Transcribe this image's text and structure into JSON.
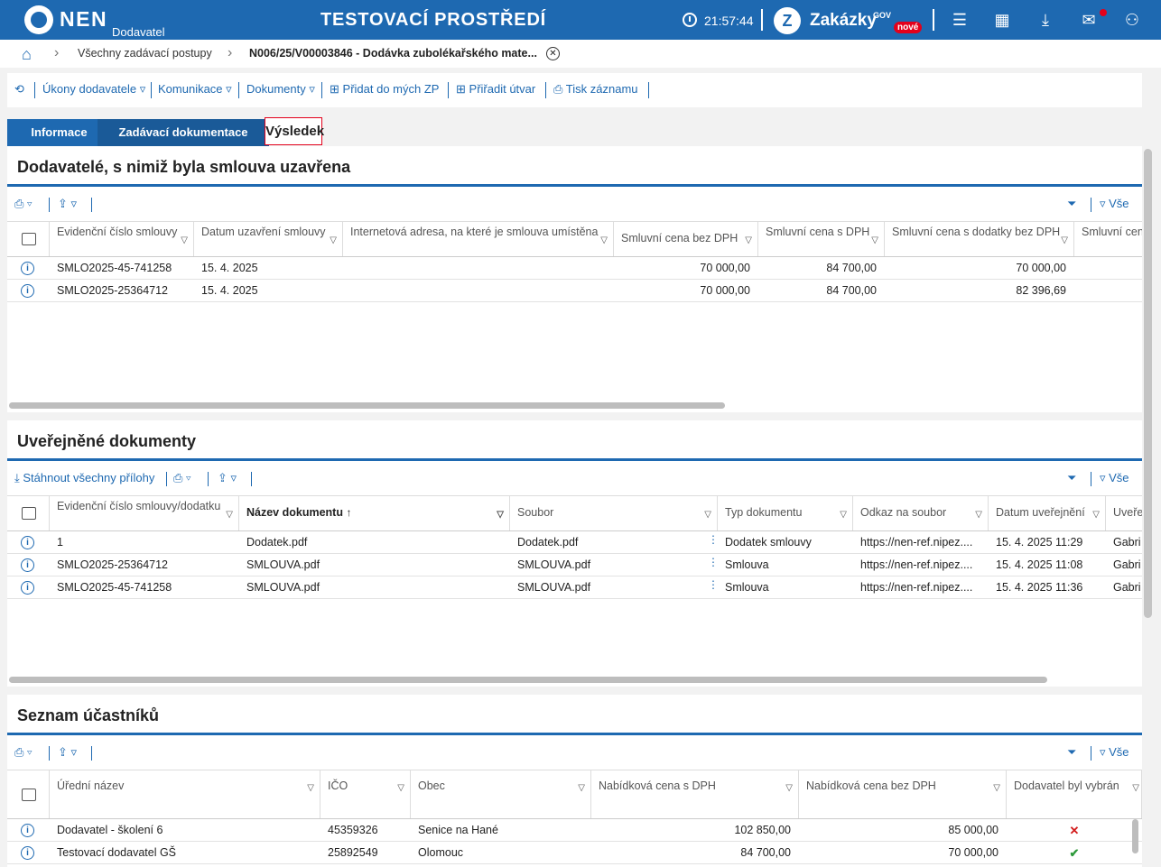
{
  "header": {
    "logo_text": "NEN",
    "logo_sub": "Dodavatel",
    "environment": "TESTOVACÍ PROSTŘEDÍ",
    "clock": "21:57:44",
    "zakazky": "Zakázky",
    "gov": "GOV",
    "nove": "nové"
  },
  "breadcrumb": {
    "items": [
      "Všechny zadávací postupy",
      "N006/25/V00003846 - Dodávka zubolékařského mate..."
    ]
  },
  "toolbar": {
    "ukony": "Úkony dodavatele",
    "komunikace": "Komunikace",
    "dokumenty": "Dokumenty",
    "pridat": "Přidat do mých ZP",
    "priradit": "Přiřadit útvar",
    "tisk": "Tisk záznamu"
  },
  "tabs": [
    "Informace",
    "Zadávací dokumentace",
    "Výsledek"
  ],
  "common": {
    "vse": "Vše"
  },
  "section1": {
    "title": "Dodavatelé, s nimiž byla smlouva uzavřena",
    "columns": [
      "Evidenční číslo smlouvy",
      "Datum uzavření smlouvy",
      "Internetová adresa, na které je smlouva umístěna",
      "Smluvní cena bez DPH",
      "Smluvní cena s DPH",
      "Smluvní cena s dodatky bez DPH",
      "Smluvní cena s DPH"
    ],
    "rows": [
      [
        "SMLO2025-45-741258",
        "15. 4. 2025",
        "",
        "70 000,00",
        "84 700,00",
        "70 000,00"
      ],
      [
        "SMLO2025-25364712",
        "15. 4. 2025",
        "",
        "70 000,00",
        "84 700,00",
        "82 396,69"
      ]
    ]
  },
  "section2": {
    "title": "Uveřejněné dokumenty",
    "download_all": "Stáhnout všechny přílohy",
    "columns": [
      "Evidenční číslo smlouvy/dodatku",
      "Název dokumentu",
      "Soubor",
      "Typ dokumentu",
      "Odkaz na soubor",
      "Datum uveřejnění",
      "Uveřejnil"
    ],
    "rows": [
      [
        "1",
        "Dodatek.pdf",
        "Dodatek.pdf",
        "Dodatek smlouvy",
        "https://nen-ref.nipez....",
        "15. 4. 2025 11:29",
        "Gabri"
      ],
      [
        "SMLO2025-25364712",
        "SMLOUVA.pdf",
        "SMLOUVA.pdf",
        "Smlouva",
        "https://nen-ref.nipez....",
        "15. 4. 2025 11:08",
        "Gabri"
      ],
      [
        "SMLO2025-45-741258",
        "SMLOUVA.pdf",
        "SMLOUVA.pdf",
        "Smlouva",
        "https://nen-ref.nipez....",
        "15. 4. 2025 11:36",
        "Gabri"
      ]
    ]
  },
  "section3": {
    "title": "Seznam účastníků",
    "columns": [
      "Úřední název",
      "IČO",
      "Obec",
      "Nabídková cena s DPH",
      "Nabídková cena bez DPH",
      "Dodavatel byl vybrán"
    ],
    "rows": [
      [
        "Dodavatel - školení 6",
        "45359326",
        "Senice na Hané",
        "102 850,00",
        "85 000,00",
        "no"
      ],
      [
        "Testovací dodavatel GŠ",
        "25892549",
        "Olomouc",
        "84 700,00",
        "70 000,00",
        "yes"
      ]
    ]
  },
  "colors": {
    "brand": "#1e69b1",
    "accent_red": "#e3001b",
    "check": "#2e9a3b"
  }
}
